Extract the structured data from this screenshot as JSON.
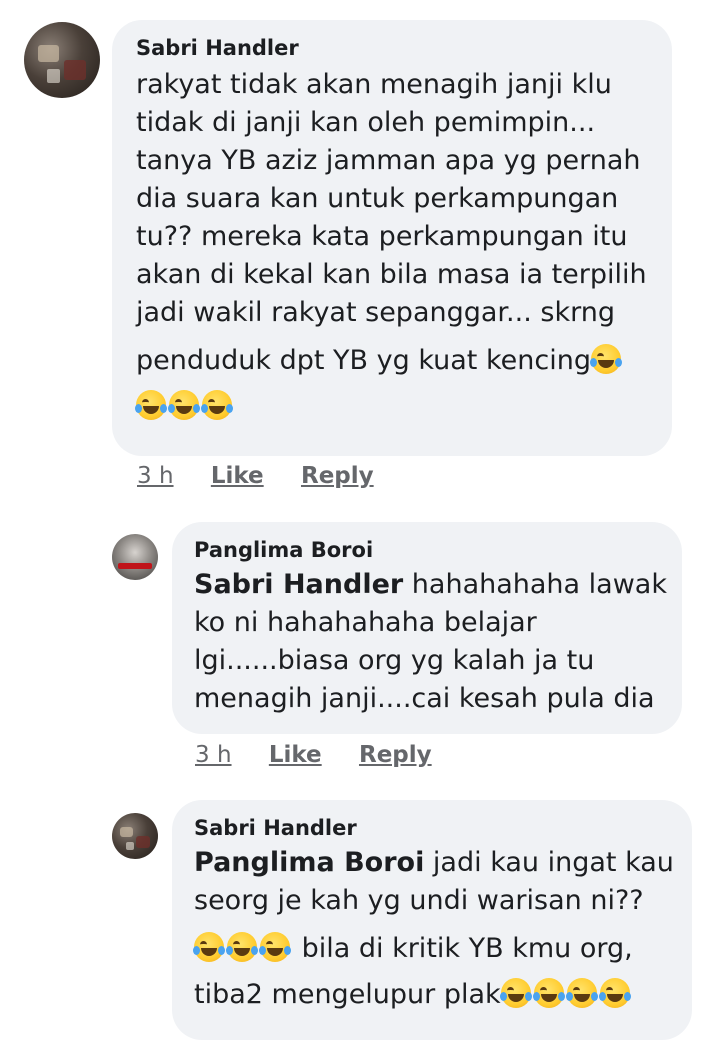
{
  "comments": [
    {
      "author": "Sabri Handler",
      "lines": [
        "rakyat tidak akan menagih janji klu",
        "tidak di janji kan oleh pemimpin...",
        "tanya YB aziz jamman apa yg pernah",
        "dia suara kan untuk perkampungan",
        "tu?? mereka kata perkampungan itu",
        "akan di kekal kan bila masa ia terpilih",
        "jadi wakil rakyat sepanggar... skrng",
        "penduduk dpt YB yg kuat kencing"
      ],
      "time": "3 h",
      "like": "Like",
      "reply": "Reply"
    },
    {
      "author": "Panglima Boroi",
      "mention": "Sabri Handler",
      "first_line_rest": " hahahahaha lawak",
      "lines": [
        "ko ni hahahahaha belajar",
        "lgi......biasa org yg kalah ja tu",
        "menagih janji....cai kesah pula dia"
      ],
      "time": "3 h",
      "like": "Like",
      "reply": "Reply"
    },
    {
      "author": "Sabri Handler",
      "mention": "Panglima Boroi",
      "first_line_rest": " jadi kau ingat kau",
      "line2": "seorg je kah yg undi warisan ni??",
      "line3": " bila di kritik YB kmu org,",
      "line4": "tiba2 mengelupur plak"
    }
  ],
  "emoji_name": "face-with-tears-of-joy-icon"
}
